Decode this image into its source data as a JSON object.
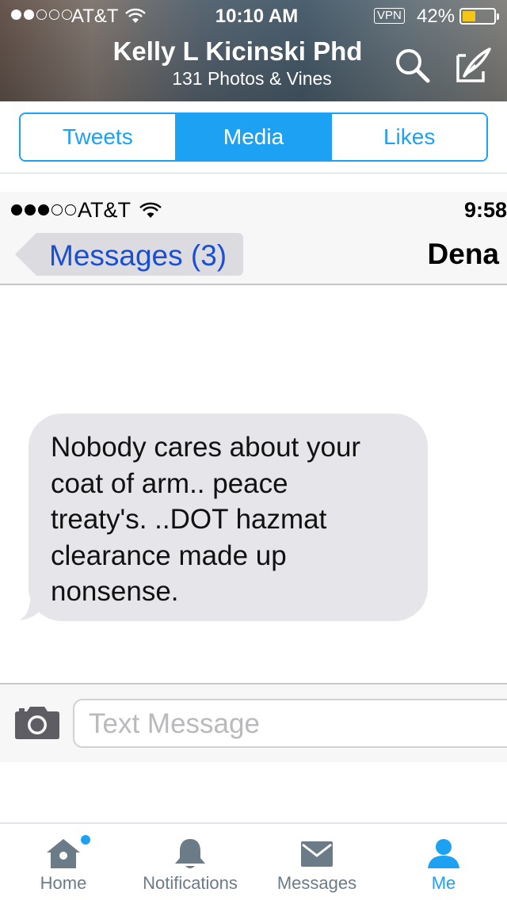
{
  "status_bar": {
    "carrier": "AT&T",
    "time": "10:10 AM",
    "vpn": "VPN",
    "battery_percent": "42%",
    "battery_level": 0.42
  },
  "profile": {
    "name": "Kelly L Kicinski Phd",
    "subtitle": "131 Photos & Vines"
  },
  "tabs": [
    {
      "label": "Tweets",
      "active": false
    },
    {
      "label": "Media",
      "active": true
    },
    {
      "label": "Likes",
      "active": false
    }
  ],
  "embedded_screenshot": {
    "status": {
      "carrier": "AT&T",
      "time": "9:58"
    },
    "nav": {
      "back_label": "Messages (3)",
      "contact": "Dena"
    },
    "message_lines": [
      "Nobody cares about your",
      "coat of arm.. peace",
      "treaty's. ..DOT hazmat",
      "clearance made up",
      "nonsense."
    ],
    "input_placeholder": "Text Message"
  },
  "bottom_nav": [
    {
      "label": "Home",
      "icon": "home-icon",
      "active": false
    },
    {
      "label": "Notifications",
      "icon": "bell-icon",
      "active": false
    },
    {
      "label": "Messages",
      "icon": "envelope-icon",
      "active": false
    },
    {
      "label": "Me",
      "icon": "person-icon",
      "active": true
    }
  ],
  "colors": {
    "accent": "#1da1f2",
    "nav_inactive": "#6b7b88",
    "ios_link": "#1b4fd1",
    "bubble": "#e5e5ea",
    "battery": "#f5c518"
  }
}
